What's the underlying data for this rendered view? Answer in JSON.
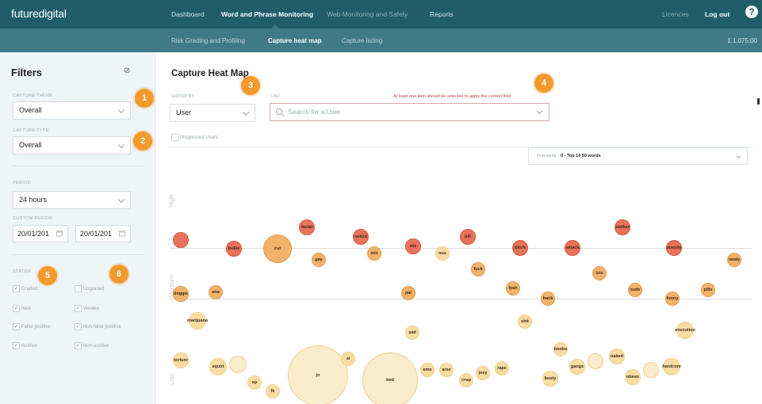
{
  "topnav": {
    "logo": "futuredigital",
    "items": [
      "Dashboard",
      "Word and Phrase Monitoring",
      "Web Monitoring and Safety",
      "Reports"
    ],
    "licences": "Licences",
    "logout": "Log out",
    "help": "?"
  },
  "subnav": {
    "items": [
      "Risk Grading and Profiling",
      "Capture heat map",
      "Capture listing"
    ],
    "version": "1.1.075.00"
  },
  "sidebar": {
    "title": "Filters",
    "reset_icon": "⊘",
    "capture_theme": {
      "label": "Capture theme",
      "value": "Overall"
    },
    "capture_type": {
      "label": "Capture type",
      "value": "Overall"
    },
    "period": {
      "label": "Period",
      "value": "24 hours"
    },
    "custom_period": {
      "label": "Custom period",
      "from": "20/01/201",
      "to": "20/01/201"
    },
    "status": {
      "label": "Status",
      "left": [
        {
          "label": "Graded",
          "checked": true
        },
        {
          "label": "New",
          "checked": true
        },
        {
          "label": "False positive",
          "checked": true
        },
        {
          "label": "Archive",
          "checked": true
        }
      ],
      "right": [
        {
          "label": "Ungraded",
          "checked": false
        },
        {
          "label": "Viewed",
          "checked": true
        },
        {
          "label": "Non-false positive",
          "checked": true
        },
        {
          "label": "Non-archive",
          "checked": true
        }
      ]
    }
  },
  "badges": [
    "1",
    "2",
    "3",
    "4",
    "5",
    "6"
  ],
  "main": {
    "title": "Capture Heat Map",
    "groupby": {
      "label": "Group by",
      "value": "User"
    },
    "list_label": "List",
    "search_placeholder": "Search for a User",
    "warning": "At least one item should be selected to apply the current filter",
    "progressed": "Progressed Users",
    "popularity": {
      "label": "Popularity",
      "value": "0 - Top 10 50 words"
    },
    "axis": {
      "high": "High",
      "medium": "Medium",
      "low": "Low"
    }
  },
  "colors": {
    "high": "#e8735a",
    "medium": "#f3b26a",
    "low": "#f8dca2",
    "very_low": "#fbeccb",
    "topbar": "#1f5d6b",
    "subbar": "#3f7a88",
    "badge": "#f39a2c"
  },
  "chart_data": {
    "type": "scatter",
    "bubbles": [
      {
        "word": "",
        "level": "high"
      },
      {
        "word": "bullie",
        "level": "high"
      },
      {
        "word": "cut",
        "level": "medium"
      },
      {
        "word": "facial",
        "level": "high"
      },
      {
        "word": "gay",
        "level": "medium"
      },
      {
        "word": "suicid",
        "level": "high"
      },
      {
        "word": "miz",
        "level": "medium"
      },
      {
        "word": "wiz",
        "level": "high"
      },
      {
        "word": "nus",
        "level": "low"
      },
      {
        "word": "pill",
        "level": "high"
      },
      {
        "word": "bitch",
        "level": "high"
      },
      {
        "word": "whack",
        "level": "high"
      },
      {
        "word": "stalker",
        "level": "high"
      },
      {
        "word": "obesity",
        "level": "high"
      },
      {
        "word": "randy",
        "level": "medium"
      },
      {
        "word": "fuck",
        "level": "medium"
      },
      {
        "word": "isis",
        "level": "medium"
      },
      {
        "word": "doggie",
        "level": "medium"
      },
      {
        "word": "ana",
        "level": "medium"
      },
      {
        "word": "pal",
        "level": "medium"
      },
      {
        "word": "fyah",
        "level": "medium"
      },
      {
        "word": "hack",
        "level": "medium"
      },
      {
        "word": "nude",
        "level": "medium"
      },
      {
        "word": "pills",
        "level": "medium"
      },
      {
        "word": "funny",
        "level": "medium"
      },
      {
        "word": "marijuana",
        "level": "low"
      },
      {
        "word": "shit",
        "level": "low"
      },
      {
        "word": "sad",
        "level": "low"
      },
      {
        "word": "execution",
        "level": "low"
      },
      {
        "word": "torture",
        "level": "low"
      },
      {
        "word": "squirt",
        "level": "low"
      },
      {
        "word": "",
        "level": "very_low"
      },
      {
        "word": "sp",
        "level": "low"
      },
      {
        "word": "fk",
        "level": "low"
      },
      {
        "word": "jo",
        "level": "very_low"
      },
      {
        "word": "si",
        "level": "low"
      },
      {
        "word": "bed",
        "level": "very_low"
      },
      {
        "word": "emo",
        "level": "low"
      },
      {
        "word": "arse",
        "level": "low"
      },
      {
        "word": "crup",
        "level": "low"
      },
      {
        "word": "joey",
        "level": "low"
      },
      {
        "word": "rape",
        "level": "low"
      },
      {
        "word": "boobs",
        "level": "low"
      },
      {
        "word": "gangs",
        "level": "low"
      },
      {
        "word": "",
        "level": "very_low"
      },
      {
        "word": "naked",
        "level": "low"
      },
      {
        "word": "hardcore",
        "level": "low"
      },
      {
        "word": "",
        "level": "very_low"
      },
      {
        "word": "obese",
        "level": "low"
      },
      {
        "word": "busty",
        "level": "low"
      }
    ]
  }
}
